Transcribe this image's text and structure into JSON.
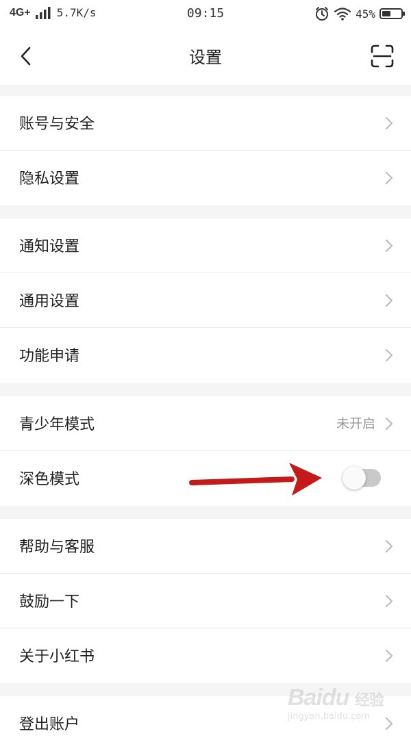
{
  "status_bar": {
    "network": "4G+",
    "speed": "5.7K/s",
    "time": "09:15",
    "battery_percent": "45%",
    "battery_level": 0.45
  },
  "nav": {
    "title": "设置",
    "back_icon": "chevron-left-icon",
    "scan_icon": "scan-icon"
  },
  "groups": [
    [
      {
        "label": "账号与安全"
      },
      {
        "label": "隐私设置"
      }
    ],
    [
      {
        "label": "通知设置"
      },
      {
        "label": "通用设置"
      },
      {
        "label": "功能申请"
      }
    ],
    [
      {
        "label": "青少年模式",
        "value": "未开启"
      },
      {
        "label": "深色模式",
        "toggle": false
      }
    ],
    [
      {
        "label": "帮助与客服"
      },
      {
        "label": "鼓励一下"
      },
      {
        "label": "关于小红书"
      }
    ],
    [
      {
        "label": "登出账户"
      }
    ]
  ],
  "annotation": {
    "color": "#c41a1a"
  },
  "watermark": {
    "logo": "Baidu",
    "sub": "jingyan.baidu.com",
    "sub_cn": "经验"
  }
}
